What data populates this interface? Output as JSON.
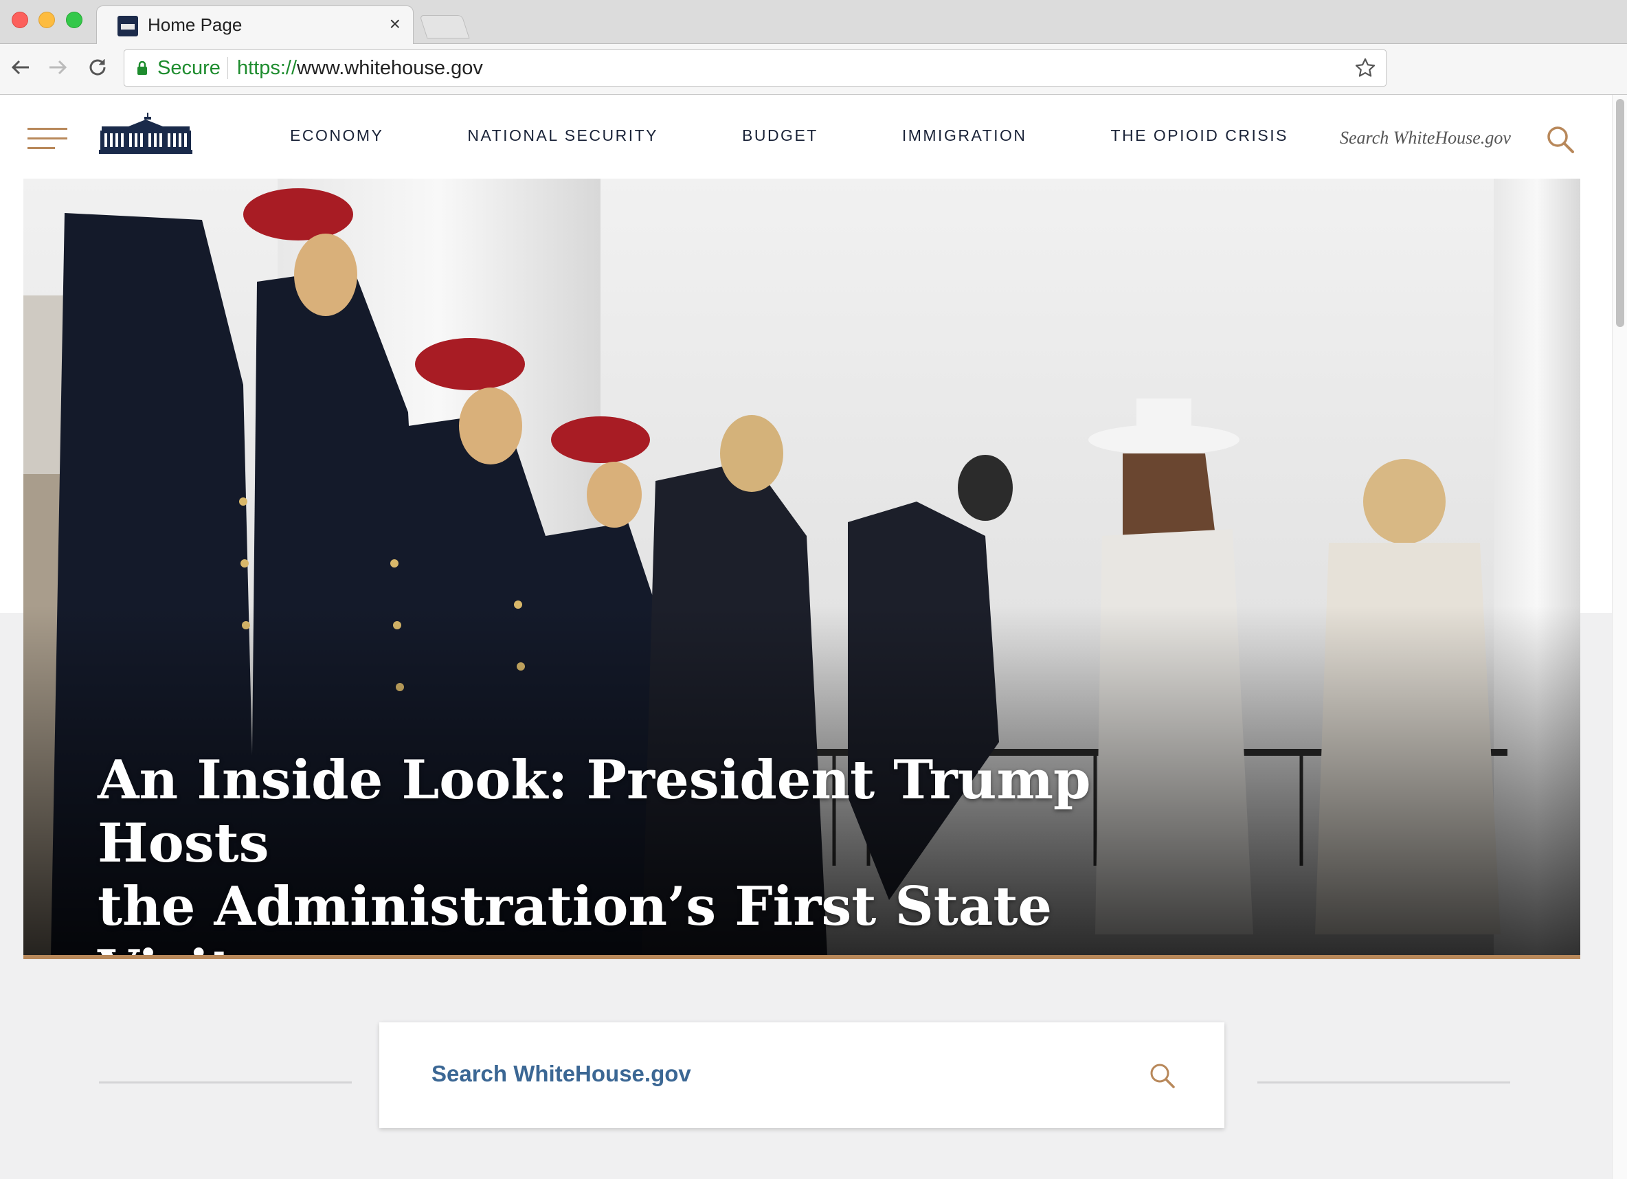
{
  "browser": {
    "tab_title": "Home Page",
    "tab_close": "×",
    "secure_label": "Secure",
    "url_scheme": "https://",
    "url_host": "www.whitehouse.gov"
  },
  "header": {
    "nav": [
      "ECONOMY",
      "NATIONAL SECURITY",
      "BUDGET",
      "IMMIGRATION",
      "THE OPIOID CRISIS"
    ],
    "search_placeholder": "Search WhiteHouse.gov"
  },
  "hero": {
    "title_line1": "An Inside Look: President Trump Hosts",
    "title_line2": "the Administration’s First State Visit"
  },
  "search_section": {
    "placeholder": "Search WhiteHouse.gov"
  },
  "colors": {
    "accent_gold": "#b8885a",
    "navy": "#1a2338",
    "link_blue": "#3b6794",
    "secure_green": "#1e8c2e"
  }
}
